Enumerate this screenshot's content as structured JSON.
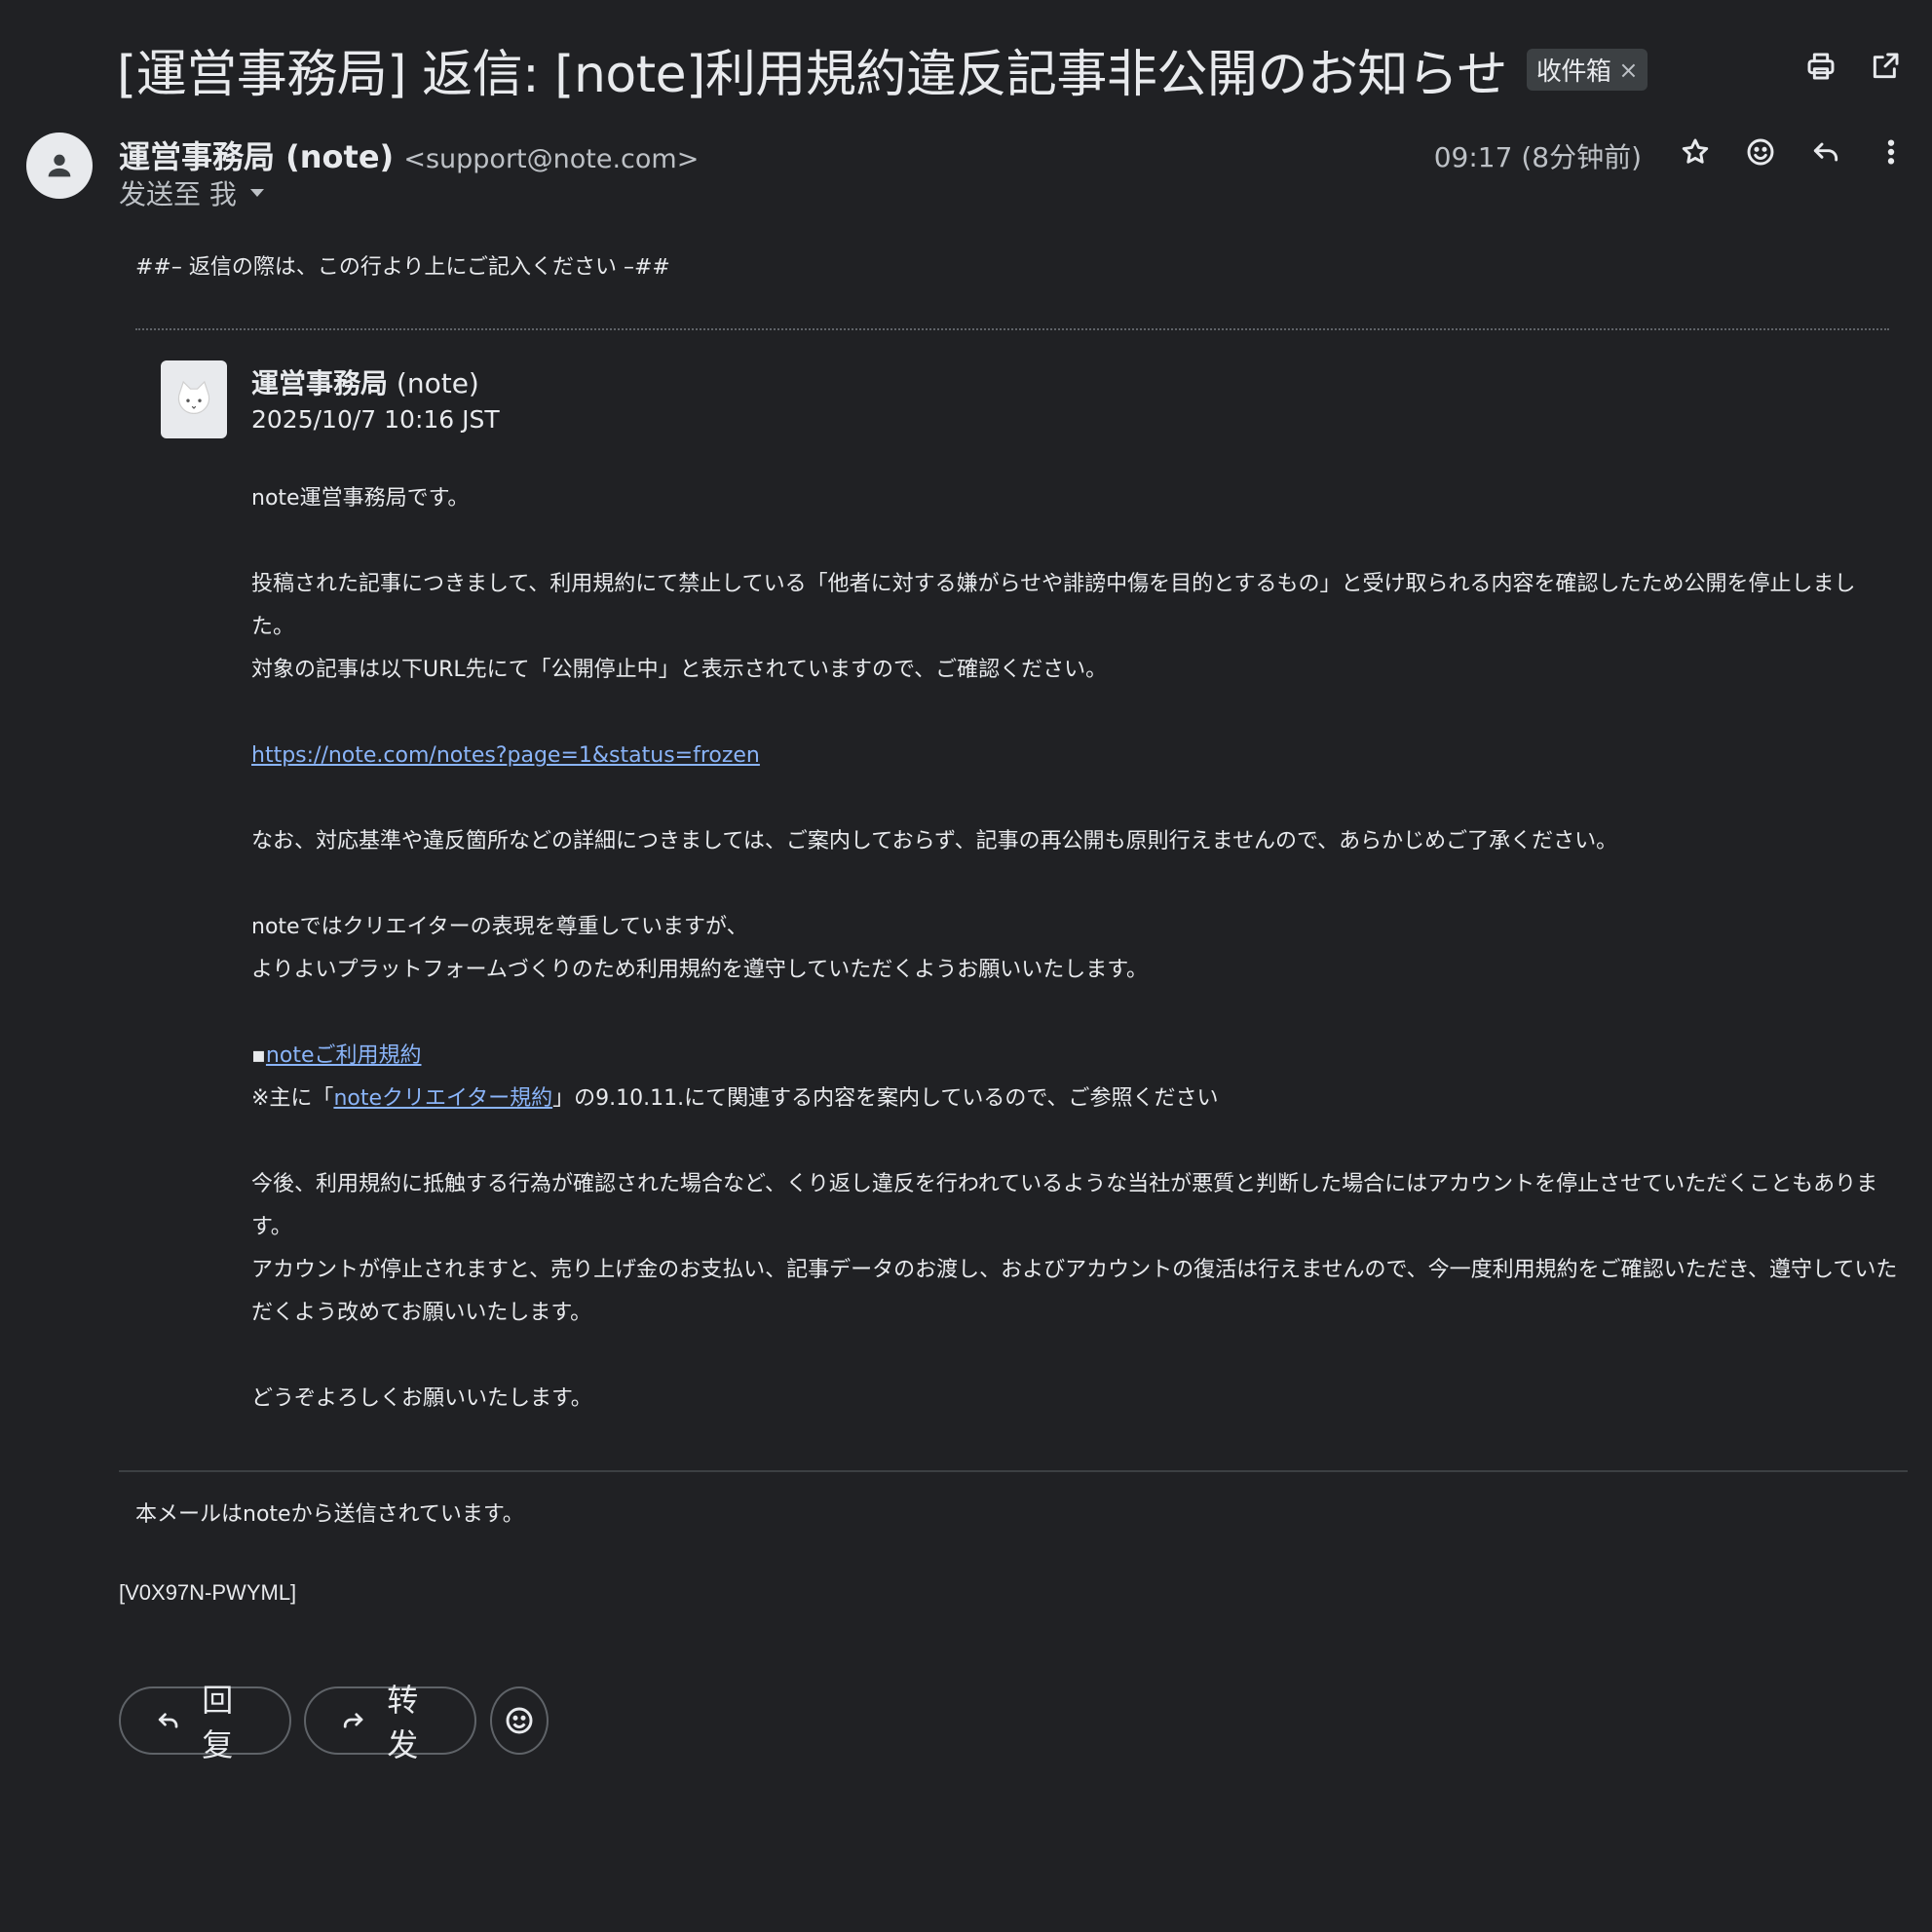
{
  "subject": {
    "title": "[運営事務局] 返信: [note]利用規約違反記事非公開のお知らせ",
    "label": "收件箱",
    "label_remove": "×"
  },
  "toolbar_icons": [
    "print-icon",
    "open-in-new-window-icon"
  ],
  "header": {
    "sender_name": "運営事務局 (note)",
    "sender_email": "<support@note.com>",
    "to_label": "发送至 我",
    "time": "09:17 (8分钟前)",
    "action_icons": [
      "star-icon",
      "emoji-icon",
      "reply-icon",
      "more-vert-icon"
    ]
  },
  "reply_marker": "##– 返信の際は、この行より上にご記入ください –##",
  "message": {
    "author_name": "運営事務局",
    "author_suffix": " (note)",
    "date": "2025/10/7 10:16 JST",
    "p1": "note運営事務局です。",
    "p2": "投稿された記事につきまして、利用規約にて禁止している「他者に対する嫌がらせや誹謗中傷を目的とするもの」と受け取られる内容を確認したため公開を停止しました。",
    "p3": "対象の記事は以下URL先にて「公開停止中」と表示されていますので、ご確認ください。",
    "url": "https://note.com/notes?page=1&status=frozen",
    "p4": "なお、対応基準や違反箇所などの詳細につきましては、ご案内しておらず、記事の再公開も原則行えませんので、あらかじめご了承ください。",
    "p5": "noteではクリエイターの表現を尊重していますが、",
    "p6": "よりよいプラットフォームづくりのため利用規約を遵守していただくようお願いいたします。",
    "bullet": "▪",
    "terms_link": "noteご利用規約",
    "creator_prefix": "※主に「",
    "creator_link": "noteクリエイター規約",
    "creator_suffix": "」の9.10.11.にて関連する内容を案内しているので、ご参照ください",
    "p7": "今後、利用規約に抵触する行為が確認された場合など、くり返し違反を行われているような当社が悪質と判断した場合にはアカウントを停止させていただくこともあります。",
    "p8": "アカウントが停止されますと、売り上げ金のお支払い、記事データのお渡し、およびアカウントの復活は行えませんので、今一度利用規約をご確認いただき、遵守していただくよう改めてお願いいたします。",
    "p9": "どうぞよろしくお願いいたします。"
  },
  "footer": {
    "note": "本メールはnoteから送信されています。",
    "ref_code": "[V0X97N-PWYML]"
  },
  "actions": {
    "reply_label": "回复",
    "forward_label": "转发"
  },
  "colors": {
    "background": "#202124",
    "text": "#e8eaed",
    "link": "#8ab4f8",
    "chip": "#3c4043"
  }
}
